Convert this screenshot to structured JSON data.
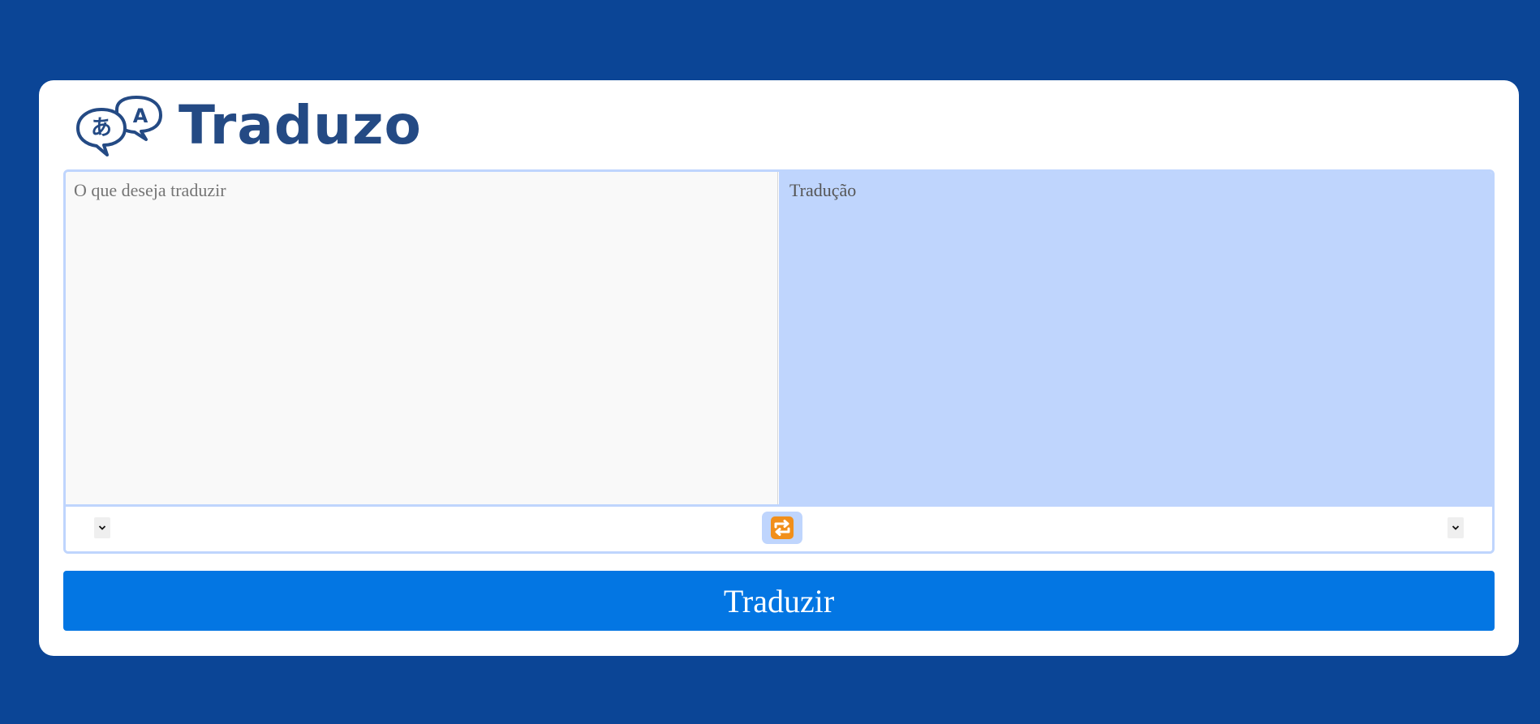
{
  "app": {
    "logo_text": "Traduzo",
    "logo_icon": "speech-bubbles-translate-icon",
    "logo_icon_glyphs": [
      "あ",
      "A"
    ]
  },
  "source": {
    "placeholder": "O que deseja traduzir",
    "value": ""
  },
  "target": {
    "placeholder": "Tradução",
    "value": ""
  },
  "controls": {
    "source_language": "",
    "target_language": "",
    "swap_icon": "repeat-arrows-icon"
  },
  "actions": {
    "translate_label": "Traduzir"
  },
  "colors": {
    "background": "#0b4596",
    "card": "#ffffff",
    "brand": "#244a84",
    "panel_accent": "#bfd5fd",
    "primary_button": "#0376e3",
    "swap_icon": "#f18f1b"
  }
}
